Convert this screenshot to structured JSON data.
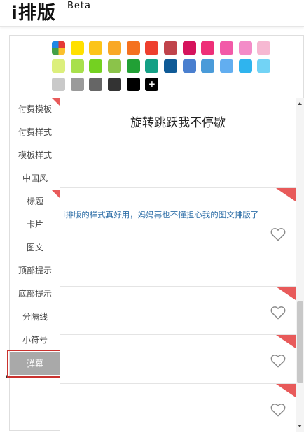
{
  "app": {
    "logo": "i排版",
    "badge": "Beta"
  },
  "palette": {
    "rows": [
      [
        "rainbow",
        "#ffe000",
        "#fcc419",
        "#f9a825",
        "#f4711f",
        "#ee3f2e",
        "#c0434b",
        "#d5135c",
        "#ee2f78",
        "#f25aa8",
        "#f38cc8",
        "#f6b8d2"
      ],
      [
        "#dcef7c",
        "#a8e04c",
        "#74d121",
        "#8bc34a",
        "#21a035",
        "#14a085",
        "#0f5a96",
        "#4a7fcf",
        "#4a9bd9",
        "#62aef0",
        "#2fb4ee",
        "#72d3f5"
      ],
      [
        "#c9c9c9",
        "#9a9a9a",
        "#666666",
        "#333333",
        "#000000",
        "plus"
      ]
    ],
    "plus_label": "+"
  },
  "sidebar": {
    "items": [
      {
        "label": "付费模板",
        "corner": true
      },
      {
        "label": "付费样式",
        "corner": false
      },
      {
        "label": "模板样式",
        "corner": false
      },
      {
        "label": "中国风",
        "corner": false
      },
      {
        "label": "标题",
        "corner": true
      },
      {
        "label": "卡片",
        "corner": false
      },
      {
        "label": "图文",
        "corner": false
      },
      {
        "label": "顶部提示",
        "corner": false
      },
      {
        "label": "底部提示",
        "corner": false
      },
      {
        "label": "分隔线",
        "corner": false
      },
      {
        "label": "小符号",
        "corner": false
      },
      {
        "label": "弹幕",
        "corner": false,
        "active": true
      }
    ]
  },
  "cards": [
    {
      "title": "旋转跳跃我不停歇",
      "has_corner": false,
      "has_heart": false
    },
    {
      "text": "i排版的样式真好用，妈妈再也不懂担心我的图文排版了",
      "has_corner": true,
      "has_heart": true
    },
    {
      "has_corner": true,
      "has_heart": true
    },
    {
      "has_corner": true,
      "has_heart": true
    },
    {
      "has_corner": true,
      "has_heart": true
    }
  ],
  "colors": {
    "accent_red": "#e85a5a",
    "active_border": "#c9322e",
    "active_bg": "#a9a9a9",
    "text_blue": "#2f6fa8"
  }
}
